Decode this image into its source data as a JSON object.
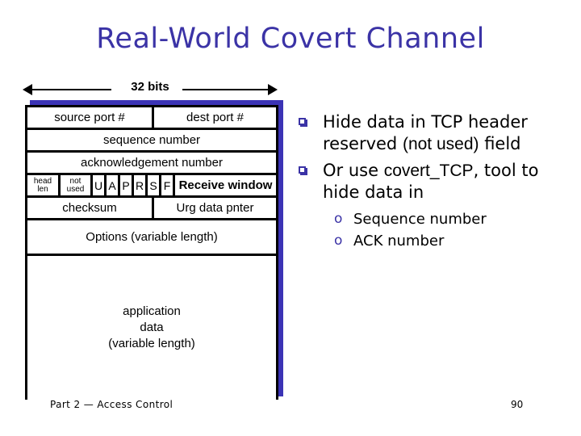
{
  "slide": {
    "title": "Real-World Covert Channel",
    "title_color": "#3b33a6",
    "accent_color": "#3b33b5",
    "footer": "Part 2 — Access Control",
    "page_number": "90"
  },
  "ruler": {
    "label": "32 bits"
  },
  "tcp_header": {
    "rows": [
      {
        "name": "ports",
        "cells": [
          {
            "text": "source port #"
          },
          {
            "text": "dest port #"
          }
        ]
      },
      {
        "name": "sequence",
        "cells": [
          {
            "text": "sequence number"
          }
        ]
      },
      {
        "name": "acknowledgement",
        "cells": [
          {
            "text": "acknowledgement number"
          }
        ]
      },
      {
        "name": "flags",
        "cells": [
          {
            "text": "head len"
          },
          {
            "text": "not used"
          },
          {
            "text": "U"
          },
          {
            "text": "A"
          },
          {
            "text": "P"
          },
          {
            "text": "R"
          },
          {
            "text": "S"
          },
          {
            "text": "F"
          },
          {
            "text": "Receive window"
          }
        ]
      },
      {
        "name": "checksum",
        "cells": [
          {
            "text": "checksum"
          },
          {
            "text": "Urg data pnter"
          }
        ]
      },
      {
        "name": "options",
        "cells": [
          {
            "text": "Options (variable length)"
          }
        ]
      },
      {
        "name": "application-data",
        "cells": [
          {
            "text": "application data (variable length)"
          }
        ]
      }
    ],
    "head_len_line1": "head",
    "head_len_line2": "len",
    "not_used_line1": "not",
    "not_used_line2": "used",
    "flag_u": "U",
    "flag_a": "A",
    "flag_p": "P",
    "flag_r": "R",
    "flag_s": "S",
    "flag_f": "F",
    "receive_window": "Receive window",
    "source_port": "source port #",
    "dest_port": "dest port #",
    "sequence_number": "sequence number",
    "ack_number": "acknowledgement number",
    "checksum": "checksum",
    "urg_pointer": "Urg data pnter",
    "options": "Options (variable length)",
    "app_data_line1": "application",
    "app_data_line2": "data",
    "app_data_line3": "(variable length)"
  },
  "bullets": {
    "b1_part1": "Hide data in TCP header reserved ",
    "b1_part2": "(not used)",
    "b1_part3": " field",
    "b2_part1": "Or use ",
    "b2_part2": "covert_TCP",
    "b2_part3": ", tool to hide data in",
    "sub1": "Sequence number",
    "sub2": "ACK number",
    "marker_square": "❑",
    "marker_circle": "o"
  }
}
